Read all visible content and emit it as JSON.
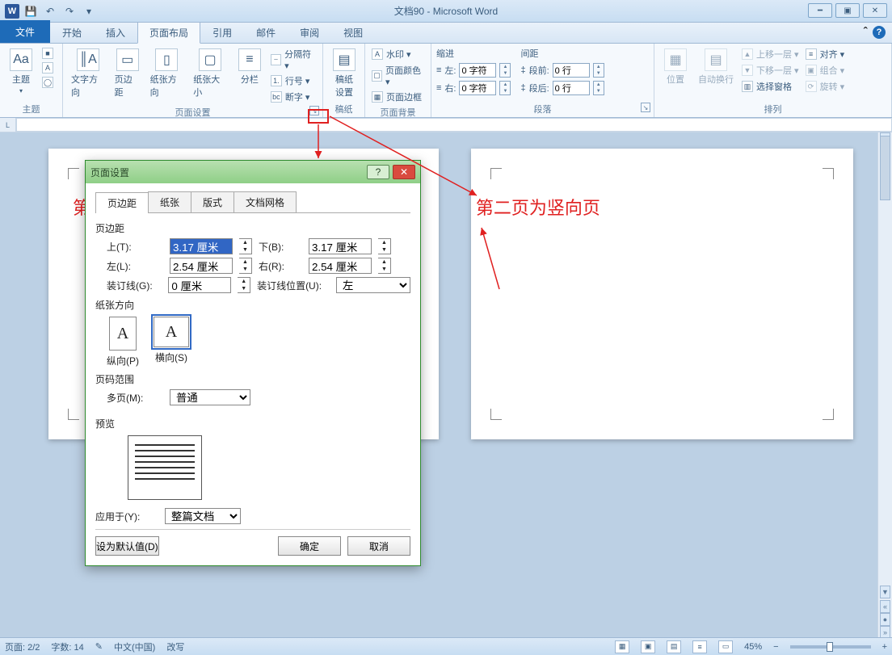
{
  "app": {
    "title": "文档90 - Microsoft Word"
  },
  "tabs": {
    "file": "文件",
    "home": "开始",
    "insert": "插入",
    "layout": "页面布局",
    "ref": "引用",
    "mail": "邮件",
    "review": "审阅",
    "view": "视图"
  },
  "ribbon": {
    "theme_group": "主题",
    "theme_btn": "主题",
    "page_setup_group": "页面设置",
    "text_direction": "文字方向",
    "margins": "页边距",
    "orientation": "纸张方向",
    "size": "纸张大小",
    "columns": "分栏",
    "breaks": "分隔符 ▾",
    "line_numbers": "行号 ▾",
    "hyphenation": "断字 ▾",
    "gaozhi_group": "稿纸",
    "gaozhi_btn": "稿纸\n设置",
    "bg_group": "页面背景",
    "watermark": "水印 ▾",
    "page_color": "页面颜色 ▾",
    "page_border": "页面边框",
    "para_group": "段落",
    "indent": "缩进",
    "spacing": "间距",
    "indent_left_lbl": "左:",
    "indent_left_val": "0 字符",
    "indent_right_lbl": "右:",
    "indent_right_val": "0 字符",
    "space_before_lbl": "段前:",
    "space_before_val": "0 行",
    "space_after_lbl": "段后:",
    "space_after_val": "0 行",
    "arrange_group": "排列",
    "position": "位置",
    "wrap": "自动换行",
    "bring_forward": "上移一层 ▾",
    "send_backward": "下移一层 ▾",
    "selection_pane": "选择窗格",
    "align": "对齐 ▾",
    "group": "组合 ▾",
    "rotate": "旋转 ▾"
  },
  "pages": {
    "page1_text": "第",
    "page2_text": "第二页为竖向页"
  },
  "dialog": {
    "title": "页面设置",
    "tabs": {
      "margins": "页边距",
      "paper": "纸张",
      "layout": "版式",
      "grid": "文档网格"
    },
    "section_margins": "页边距",
    "top_lbl": "上(T):",
    "top_val": "3.17 厘米",
    "bottom_lbl": "下(B):",
    "bottom_val": "3.17 厘米",
    "left_lbl": "左(L):",
    "left_val": "2.54 厘米",
    "right_lbl": "右(R):",
    "right_val": "2.54 厘米",
    "gutter_lbl": "装订线(G):",
    "gutter_val": "0 厘米",
    "gutter_pos_lbl": "装订线位置(U):",
    "gutter_pos_val": "左",
    "orient_section": "纸张方向",
    "orient_portrait": "纵向(P)",
    "orient_landscape": "横向(S)",
    "range_section": "页码范围",
    "multi_lbl": "多页(M):",
    "multi_val": "普通",
    "preview_section": "预览",
    "apply_lbl": "应用于(Y):",
    "apply_val": "整篇文档",
    "default_btn": "设为默认值(D)",
    "ok_btn": "确定",
    "cancel_btn": "取消"
  },
  "status": {
    "page": "页面: 2/2",
    "words": "字数: 14",
    "lang": "中文(中国)",
    "mode": "改写",
    "zoom": "45%"
  }
}
